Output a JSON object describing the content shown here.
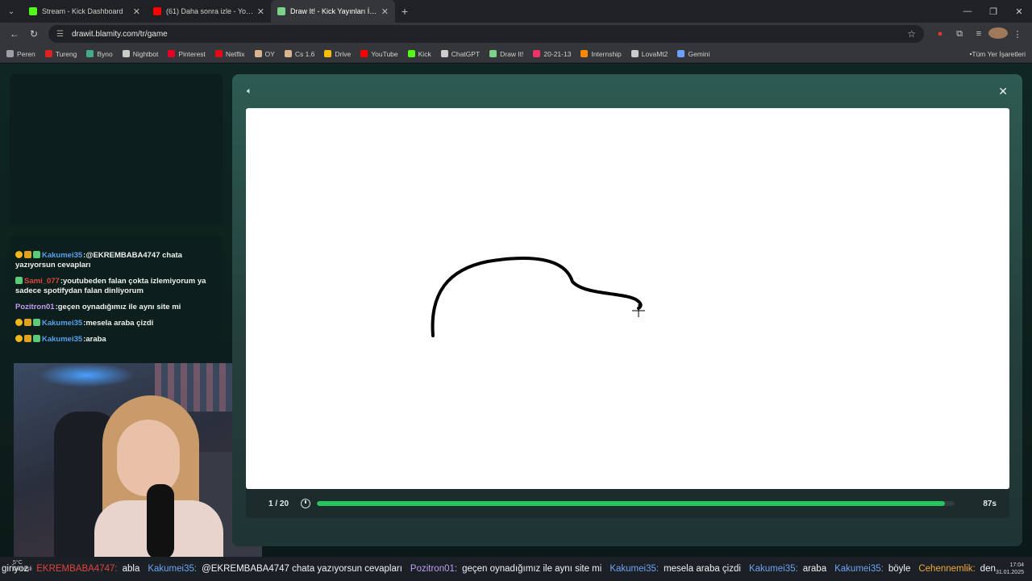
{
  "browser": {
    "tabs": [
      {
        "title": "Stream - Kick Dashboard",
        "color": "#53fc18",
        "active": false
      },
      {
        "title": "(61) Daha sonra izle - YouTube",
        "color": "#ff0000",
        "active": false
      },
      {
        "title": "Draw It! - Kick Yayınları İçin Çiz",
        "color": "#7bd389",
        "active": true
      }
    ],
    "new_tab": "+",
    "url": "drawit.blamity.com/tr/game",
    "bookmarks": [
      {
        "label": "Peren",
        "color": "#9aa0a6"
      },
      {
        "label": "Tureng",
        "color": "#d22"
      },
      {
        "label": "Byno",
        "color": "#4a8"
      },
      {
        "label": "Nightbot",
        "color": "#ccc"
      },
      {
        "label": "Pinterest",
        "color": "#e60023"
      },
      {
        "label": "Netflix",
        "color": "#e50914"
      },
      {
        "label": "OY",
        "color": "#d9b48c"
      },
      {
        "label": "Cs 1.6",
        "color": "#d9b48c"
      },
      {
        "label": "Drive",
        "color": "#fbbc04"
      },
      {
        "label": "YouTube",
        "color": "#ff0000"
      },
      {
        "label": "Kick",
        "color": "#53fc18"
      },
      {
        "label": "ChatGPT",
        "color": "#ccc"
      },
      {
        "label": "Draw It!",
        "color": "#7bd389"
      },
      {
        "label": "20-21-13",
        "color": "#e36"
      },
      {
        "label": "Internship",
        "color": "#f80"
      },
      {
        "label": "LovaMt2",
        "color": "#ccc"
      },
      {
        "label": "Gemini",
        "color": "#6aa0ff"
      }
    ],
    "all_bookmarks": "Tüm Yer İşaretleri"
  },
  "chat": {
    "messages": [
      {
        "user": "Kakumei35",
        "user_color": "#5aa0f0",
        "badges": [
          "gold",
          "crown",
          "green"
        ],
        "text": ":@EKREMBABA4747 chata yazıyorsun cevapları"
      },
      {
        "user": "Sami_077",
        "user_color": "#e0463b",
        "badges": [
          "green"
        ],
        "text": ":youtubeden falan çokta izlemiyorum ya sadece spotifydan falan dinliyorum"
      },
      {
        "user": "Pozitron01",
        "user_color": "#c29cf2",
        "badges": [],
        "text": ":geçen oynadığımız ile aynı site mi"
      },
      {
        "user": "Kakumei35",
        "user_color": "#5aa0f0",
        "badges": [
          "gold",
          "crown",
          "green"
        ],
        "text": ":mesela araba çizdi"
      },
      {
        "user": "Kakumei35",
        "user_color": "#5aa0f0",
        "badges": [
          "gold",
          "crown",
          "green"
        ],
        "text": ":araba"
      }
    ]
  },
  "game": {
    "round": "1 / 20",
    "time_left": "87s",
    "progress": 0.985
  },
  "ticker": {
    "items": [
      {
        "user": "",
        "text": "giriyoz"
      },
      {
        "user": "EKREMBABA4747:",
        "user_style": "red",
        "text": "abla"
      },
      {
        "user": "Kakumei35:",
        "user_style": "blue",
        "text": "@EKREMBABA4747 chata yazıyorsun cevapları"
      },
      {
        "user": "Pozitron01:",
        "user_style": "purple",
        "text": "geçen oynadığımız ile aynı site mi"
      },
      {
        "user": "Kakumei35:",
        "user_style": "blue",
        "text": "mesela araba çizdi"
      },
      {
        "user": "Kakumei35:",
        "user_style": "blue",
        "text": "araba"
      },
      {
        "user": "Kakumei35:",
        "user_style": "blue",
        "text": "böyle"
      },
      {
        "user": "Cehennemlik:",
        "user_style": "orange",
        "text": "deneme"
      }
    ]
  },
  "tray": {
    "weather": "5°C",
    "weather_sub": "Güneşli",
    "time": "17:04",
    "date": "31.01.2025"
  }
}
